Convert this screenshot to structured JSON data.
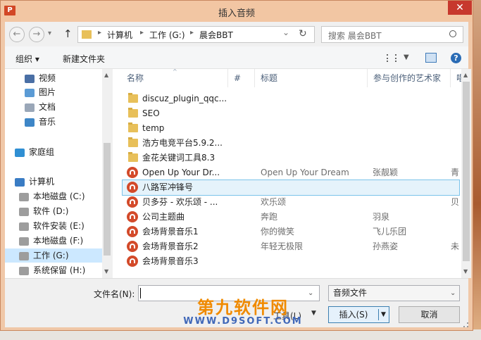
{
  "window": {
    "title": "插入音频",
    "app_icon_text": "P",
    "close_symbol": "✕"
  },
  "nav": {
    "back_symbol": "←",
    "forward_symbol": "→",
    "up_symbol": "↑",
    "breadcrumb": [
      "计算机",
      "工作 (G:)",
      "晨会BBT"
    ],
    "separator": "▸",
    "dropdown_symbol": "⌄",
    "refresh_symbol": "↻",
    "search_placeholder": "搜索 晨会BBT"
  },
  "toolbar": {
    "organize_label": "组织 ▾",
    "new_folder_label": "新建文件夹"
  },
  "sidebar": {
    "items": [
      {
        "label": "视频",
        "icon": "video-icon",
        "color": "#4a6fa5"
      },
      {
        "label": "图片",
        "icon": "picture-icon",
        "color": "#5b9bd5"
      },
      {
        "label": "文档",
        "icon": "document-icon",
        "color": "#9aa7b8"
      },
      {
        "label": "音乐",
        "icon": "music-icon",
        "color": "#3e86c7"
      },
      {
        "label": "家庭组",
        "icon": "homegroup-icon",
        "color": "#2f8fd3"
      },
      {
        "label": "计算机",
        "icon": "computer-icon",
        "color": "#3a7cc4"
      },
      {
        "label": "本地磁盘 (C:)",
        "icon": "drive-icon",
        "color": "#9d9d9d"
      },
      {
        "label": "软件 (D:)",
        "icon": "drive-icon",
        "color": "#9d9d9d"
      },
      {
        "label": "软件安装 (E:)",
        "icon": "drive-icon",
        "color": "#9d9d9d"
      },
      {
        "label": "本地磁盘 (F:)",
        "icon": "drive-icon",
        "color": "#9d9d9d"
      },
      {
        "label": "工作 (G:)",
        "icon": "drive-icon",
        "color": "#9d9d9d"
      },
      {
        "label": "系统保留 (H:)",
        "icon": "drive-icon",
        "color": "#9d9d9d"
      }
    ]
  },
  "columns": {
    "name": "名称",
    "number": "#",
    "title": "标题",
    "artist": "参与创作的艺术家",
    "extra": "唱"
  },
  "files": [
    {
      "type": "folder",
      "name": "discuz_plugin_qqc...",
      "title": "",
      "artist": "",
      "extra": ""
    },
    {
      "type": "folder",
      "name": "SEO",
      "title": "",
      "artist": "",
      "extra": ""
    },
    {
      "type": "folder",
      "name": "temp",
      "title": "",
      "artist": "",
      "extra": ""
    },
    {
      "type": "folder",
      "name": "浩方电竞平台5.9.2...",
      "title": "",
      "artist": "",
      "extra": ""
    },
    {
      "type": "folder",
      "name": "金花关键词工具8.3",
      "title": "",
      "artist": "",
      "extra": ""
    },
    {
      "type": "audio",
      "name": "Open Up Your Dr...",
      "title": "Open Up Your Dream",
      "artist": "张靓颖",
      "extra": "青"
    },
    {
      "type": "audio",
      "name": "八路军冲锋号",
      "title": "",
      "artist": "",
      "extra": ""
    },
    {
      "type": "audio",
      "name": "贝多芬 - 欢乐颂 - ...",
      "title": "欢乐颂",
      "artist": "",
      "extra": "贝"
    },
    {
      "type": "audio",
      "name": "公司主题曲",
      "title": "奔跑",
      "artist": "羽泉",
      "extra": ""
    },
    {
      "type": "audio",
      "name": "会场背景音乐1",
      "title": "你的微笑",
      "artist": "飞儿乐团",
      "extra": ""
    },
    {
      "type": "audio",
      "name": "会场背景音乐2",
      "title": "年轻无极限",
      "artist": "孙燕姿",
      "extra": "未"
    },
    {
      "type": "audio",
      "name": "会场背景音乐3",
      "title": "",
      "artist": "",
      "extra": ""
    }
  ],
  "selected_index": 6,
  "bottom": {
    "filename_label": "文件名(N):",
    "filename_value": "",
    "filetype_value": "音频文件",
    "tools_label": "工具(L)",
    "insert_label": "插入(S)",
    "cancel_label": "取消"
  },
  "watermark": {
    "logo": "第九软件网",
    "url": "WWW.D9SOFT.COM"
  },
  "colors": {
    "accent_selected_bg": "#e5f3fb",
    "accent_selected_border": "#7bc3ea",
    "audio_icon": "#d34a2a",
    "folder": "#e8c05a"
  }
}
